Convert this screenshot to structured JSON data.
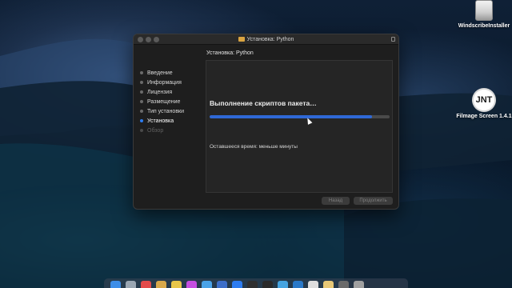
{
  "window": {
    "title": "Установка: Python",
    "header": "Установка: Python"
  },
  "sidebar": {
    "steps": [
      {
        "label": "Введение",
        "state": "done"
      },
      {
        "label": "Информация",
        "state": "done"
      },
      {
        "label": "Лицензия",
        "state": "done"
      },
      {
        "label": "Размещение",
        "state": "done"
      },
      {
        "label": "Тип установки",
        "state": "done"
      },
      {
        "label": "Установка",
        "state": "active"
      },
      {
        "label": "Обзор",
        "state": "pending"
      }
    ]
  },
  "main": {
    "status": "Выполнение скриптов пакета…",
    "progress": 0.9,
    "remaining": "Оставшееся время: меньше минуты"
  },
  "buttons": {
    "back": "Назад",
    "continue": "Продолжить"
  },
  "desktop": {
    "icons": [
      {
        "label": "WindscribeInstaller",
        "icon": "drive-icon"
      },
      {
        "label": "Filmage Screen 1.4.1",
        "icon": "filmage-app-icon",
        "glyph": "JNT"
      }
    ]
  },
  "colors": {
    "accent": "#2f68d6",
    "window_bg": "#1e1e1e",
    "active_dot": "#2d7cf0"
  },
  "dock": {
    "apps": [
      {
        "name": "finder-icon",
        "color": "#3d8ee8"
      },
      {
        "name": "launchpad-icon",
        "color": "#9aa6b2"
      },
      {
        "name": "calendar-icon",
        "color": "#e34b4b"
      },
      {
        "name": "notes-icon",
        "color": "#d8a84a"
      },
      {
        "name": "stickies-icon",
        "color": "#e8c64a"
      },
      {
        "name": "music-icon",
        "color": "#c54ee0"
      },
      {
        "name": "chrome-icon",
        "color": "#4aa3e8"
      },
      {
        "name": "safari-icon",
        "color": "#3d6ec8"
      },
      {
        "name": "app-store-icon",
        "color": "#2d7cf0"
      },
      {
        "name": "pycharm-icon",
        "color": "#2f2f2f"
      },
      {
        "name": "terminal-icon",
        "color": "#2a2a2a"
      },
      {
        "name": "telegram-icon",
        "color": "#46a4e0"
      },
      {
        "name": "vscode-icon",
        "color": "#2a79c8"
      },
      {
        "name": "preview-icon",
        "color": "#dedede"
      },
      {
        "name": "folder-icon",
        "color": "#e8c876"
      },
      {
        "name": "screenshot-icon",
        "color": "#6a6a6a"
      },
      {
        "name": "trash-icon",
        "color": "#a0a0a0"
      }
    ]
  }
}
